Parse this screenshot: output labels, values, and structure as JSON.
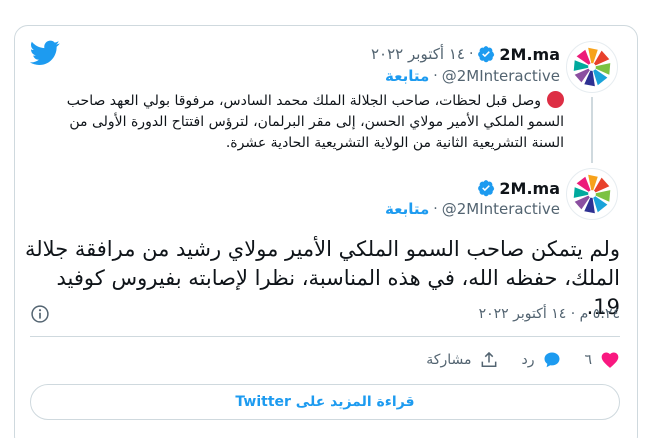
{
  "brand": {
    "accent": "#1d9bf0",
    "like_color": "#f91880",
    "red_circle_color": "#dd2e44"
  },
  "quoted_tweet": {
    "author_name": "2M.ma",
    "handle": "@2MInteractive",
    "follow_label": "متابعة",
    "date": "١٤ أكتوبر ٢٠٢٢",
    "separator": "·",
    "text": "وصل قبل لحظات، صاحب الجلالة الملك محمد السادس، مرفوقا بولي العهد صاحب السمو الملكي الأمير مولاي الحسن، إلى مقر البرلمان، لترؤس افتتاح الدورة الأولى من السنة التشريعية الثانية من الولاية التشريعية الحادية عشرة."
  },
  "main_tweet": {
    "author_name": "2M.ma",
    "handle": "@2MInteractive",
    "follow_label": "متابعة",
    "separator": "·",
    "text": "ولم يتمكن صاحب السمو الملكي الأمير مولاي رشيد من مرافقة جلالة الملك، حفظه الله، في هذه المناسبة، نظرا لإصابته بفيروس كوفيد 19.",
    "timestamp": "٥:٢٤ م · ١٤ أكتوبر ٢٠٢٢"
  },
  "actions": {
    "like_count": "٦",
    "reply_label": "رد",
    "share_label": "مشاركة"
  },
  "more_button_label": "قراءة المزيد على Twitter",
  "icons": {
    "twitter": "twitter-bird-icon",
    "verified": "verified-badge-icon",
    "info": "info-icon",
    "like": "heart-icon",
    "reply": "reply-bubble-icon",
    "share": "share-icon",
    "bullet": "red-circle-emoji"
  }
}
